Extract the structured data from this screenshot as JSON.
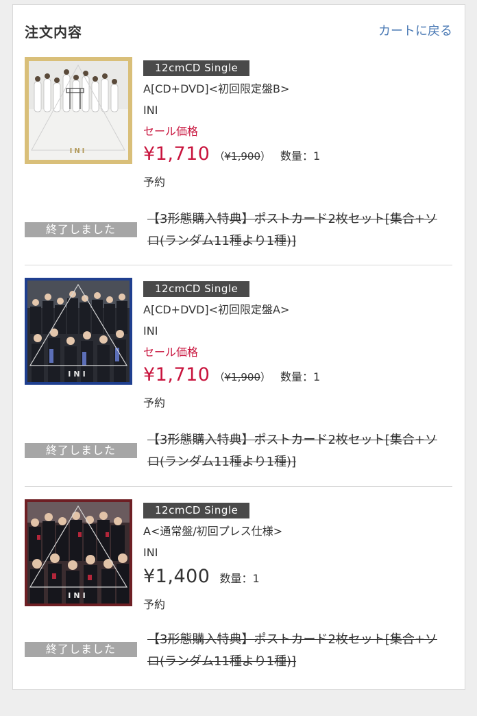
{
  "header": {
    "title": "注文内容",
    "back_link": "カートに戻る"
  },
  "items": [
    {
      "format": "12cmCD Single",
      "title": "A[CD+DVD]<初回限定盤B>",
      "artist": "INI",
      "sale_label": "セール価格",
      "price": "¥1,710",
      "original_price_open": "（",
      "original_price": "¥1,900",
      "original_price_close": "）",
      "quantity": "数量：1",
      "status": "予約",
      "ended_label": "終了しました",
      "bonus": "【3形態購入特典】ポストカード2枚セット[集合+ソロ(ランダム11種より1種)]",
      "jacket_logo": "INI",
      "jacket_frame_color": "#d9bf79"
    },
    {
      "format": "12cmCD Single",
      "title": "A[CD+DVD]<初回限定盤A>",
      "artist": "INI",
      "sale_label": "セール価格",
      "price": "¥1,710",
      "original_price_open": "（",
      "original_price": "¥1,900",
      "original_price_close": "）",
      "quantity": "数量：1",
      "status": "予約",
      "ended_label": "終了しました",
      "bonus": "【3形態購入特典】ポストカード2枚セット[集合+ソロ(ランダム11種より1種)]",
      "jacket_logo": "INI",
      "jacket_frame_color": "#1f3f8f"
    },
    {
      "format": "12cmCD Single",
      "title": "A<通常盤/初回プレス仕様>",
      "artist": "INI",
      "price": "¥1,400",
      "quantity": "数量：1",
      "status": "予約",
      "ended_label": "終了しました",
      "bonus": "【3形態購入特典】ポストカード2枚セット[集合+ソロ(ランダム11種より1種)]",
      "jacket_logo": "INI",
      "jacket_frame_color": "#6e1f24"
    }
  ],
  "colors": {
    "link": "#4a79b4",
    "sale": "#c8143d",
    "badge_dark": "#4a4a4a",
    "badge_ended": "#a6a6a6"
  }
}
